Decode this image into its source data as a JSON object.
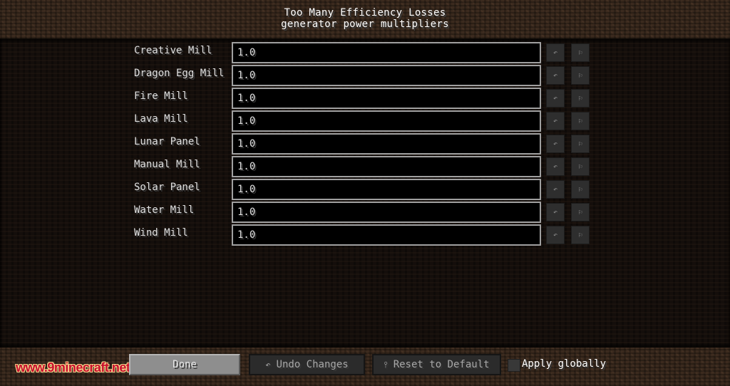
{
  "header": {
    "title": "Too Many Efficiency Losses",
    "subtitle": "generator power multipliers"
  },
  "entries": [
    {
      "label": "Creative Mill",
      "value": "1.0"
    },
    {
      "label": "Dragon Egg Mill",
      "value": "1.0"
    },
    {
      "label": "Fire Mill",
      "value": "1.0"
    },
    {
      "label": "Lava Mill",
      "value": "1.0"
    },
    {
      "label": "Lunar Panel",
      "value": "1.0"
    },
    {
      "label": "Manual Mill",
      "value": "1.0"
    },
    {
      "label": "Solar Panel",
      "value": "1.0"
    },
    {
      "label": "Water Mill",
      "value": "1.0"
    },
    {
      "label": "Wind Mill",
      "value": "1.0"
    }
  ],
  "row_icons": {
    "undo": "↶",
    "reset": "⚐"
  },
  "footer": {
    "done_label": "Done",
    "undo_label": "Undo Changes",
    "undo_icon": "↶",
    "reset_label": "Reset to Default",
    "reset_icon": "⫯",
    "apply_globally_label": "Apply globally",
    "apply_globally_checked": false
  },
  "watermark": "www.9minecraft.net"
}
